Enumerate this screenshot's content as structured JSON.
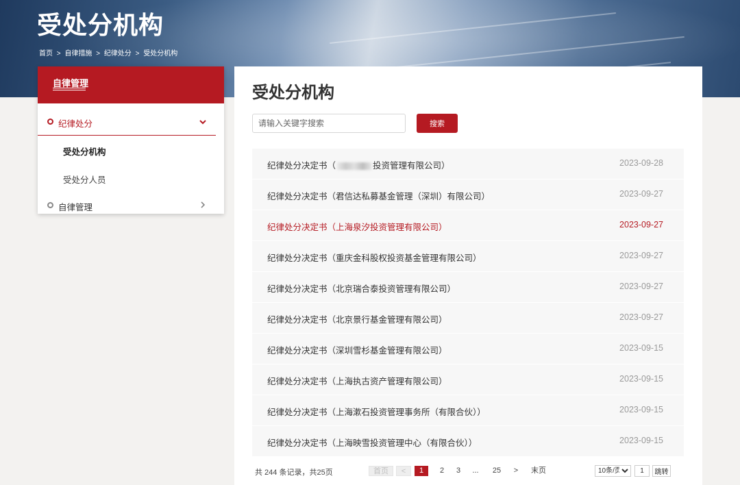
{
  "banner": {
    "title": "受处分机构",
    "breadcrumb": [
      "首页",
      ">",
      "自律措施",
      ">",
      "纪律处分",
      ">",
      "受处分机构"
    ]
  },
  "sidebar": {
    "title": "自律管理",
    "groups": [
      {
        "label": "纪律处分",
        "expanded": true,
        "chevron": "chevron-down-icon",
        "items": [
          {
            "label": "受处分机构",
            "active": true
          },
          {
            "label": "受处分人员",
            "active": false
          }
        ]
      },
      {
        "label": "自律管理",
        "expanded": false,
        "chevron": "chevron-right-icon"
      }
    ]
  },
  "main": {
    "title": "受处分机构",
    "search": {
      "placeholder": "请输入关键字搜索",
      "value": "",
      "button_label": "搜索"
    },
    "items": [
      {
        "title_prefix": "纪律处分决定书（",
        "title_suffix": "投资管理有限公司）",
        "date": "2023-09-28",
        "redacted": true
      },
      {
        "title": "纪律处分决定书（君信达私募基金管理（深圳）有限公司）",
        "date": "2023-09-27"
      },
      {
        "title": "纪律处分决定书（上海泉汐投资管理有限公司）",
        "date": "2023-09-27",
        "highlight": true
      },
      {
        "title": "纪律处分决定书（重庆金科股权投资基金管理有限公司）",
        "date": "2023-09-27"
      },
      {
        "title": "纪律处分决定书（北京瑞合泰投资管理有限公司）",
        "date": "2023-09-27"
      },
      {
        "title": "纪律处分决定书（北京景行基金管理有限公司）",
        "date": "2023-09-27"
      },
      {
        "title": "纪律处分决定书（深圳雪杉基金管理有限公司）",
        "date": "2023-09-15"
      },
      {
        "title": "纪律处分决定书（上海执古资产管理有限公司）",
        "date": "2023-09-15"
      },
      {
        "title": "纪律处分决定书（上海漱石投资管理事务所（有限合伙））",
        "date": "2023-09-15"
      },
      {
        "title": "纪律处分决定书（上海映雪投资管理中心（有限合伙））",
        "date": "2023-09-15"
      }
    ]
  },
  "pagination": {
    "summary": "共 244 条记录，共25页",
    "first": "首页",
    "prev": "<",
    "pages": [
      "1",
      "2",
      "3",
      "...",
      "25"
    ],
    "current": "1",
    "next": ">",
    "last": "末页",
    "page_size": "10条/页",
    "jump_value": "1",
    "jump_label": "跳转"
  },
  "colors": {
    "accent": "#b51a22",
    "date": "#9a9a9a",
    "row_bg": "#f7f7f7"
  }
}
